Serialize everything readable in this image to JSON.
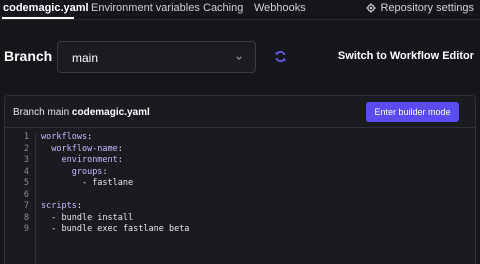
{
  "tabs": {
    "active": "codemagic.yaml",
    "env": "Environment variables",
    "caching": "Caching",
    "webhooks": "Webhooks"
  },
  "repo_settings": {
    "label": "Repository settings",
    "icon": "gear-icon"
  },
  "branch": {
    "label": "Branch",
    "selected": "main",
    "refresh_icon": "refresh-icon"
  },
  "switch_editor": "Switch to Workflow Editor",
  "panel": {
    "title_prefix": "Branch main",
    "title_file": "codemagic.yaml",
    "builder_button": "Enter builder mode"
  },
  "code_lines": [
    {
      "n": "1",
      "key": "workflows",
      "suffix": ":",
      "indent": ""
    },
    {
      "n": "2",
      "key": "workflow-name",
      "suffix": ":",
      "indent": "  "
    },
    {
      "n": "3",
      "key": "environment",
      "suffix": ":",
      "indent": "    "
    },
    {
      "n": "4",
      "key": "groups",
      "suffix": ":",
      "indent": "      "
    },
    {
      "n": "5",
      "key": "",
      "suffix": "- fastlane",
      "indent": "        "
    },
    {
      "n": "6",
      "key": "",
      "suffix": "",
      "indent": ""
    },
    {
      "n": "7",
      "key": "scripts",
      "suffix": ":",
      "indent": ""
    },
    {
      "n": "8",
      "key": "",
      "suffix": "- bundle install",
      "indent": "  "
    },
    {
      "n": "9",
      "key": "",
      "suffix": "- bundle exec fastlane beta",
      "indent": "  "
    }
  ],
  "colors": {
    "background": "#15161a",
    "accent": "#5a4cf0",
    "yaml_key": "#c8b6ff",
    "refresh": "#6c5cf5"
  }
}
